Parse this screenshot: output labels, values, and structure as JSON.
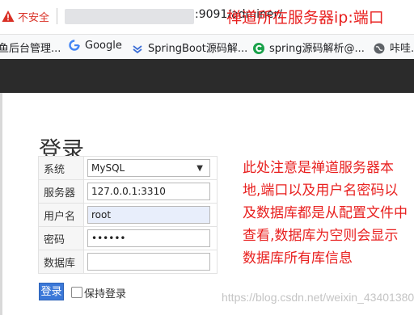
{
  "addressbar": {
    "security_label": "不安全",
    "url_visible": ":9091/adminer/",
    "annotation": "禅道所在服务器ip:端口"
  },
  "bookmarks": [
    {
      "label": "鱼后台管理...",
      "icon": "folder-icon"
    },
    {
      "label": "Google",
      "icon": "google-icon"
    },
    {
      "label": "SpringBoot源码解...",
      "icon": "spring-icon"
    },
    {
      "label": "spring源码解析@...",
      "icon": "c-icon"
    },
    {
      "label": "咔哇...",
      "icon": "globe-icon"
    }
  ],
  "login": {
    "title": "登录",
    "fields": {
      "system_label": "系统",
      "system_value": "MySQL",
      "server_label": "服务器",
      "server_value": "127.0.0.1:3310",
      "username_label": "用户名",
      "username_value": "root",
      "password_label": "密码",
      "password_value": "••••••",
      "database_label": "数据库",
      "database_value": ""
    },
    "login_button": "登录",
    "remember_label": "保持登录"
  },
  "annotation_note": "此处注意是禅道服务器本地,端口以及用户名密码以及数据库都是从配置文件中查看,数据库为空则会显示数据库所有库信息",
  "watermark": "https://blog.csdn.net/weixin_43401380",
  "colors": {
    "annotation": "#e8201f",
    "insecure": "#d93025",
    "login_button": "#3b78d8",
    "dark_header": "#2b2b2b"
  }
}
